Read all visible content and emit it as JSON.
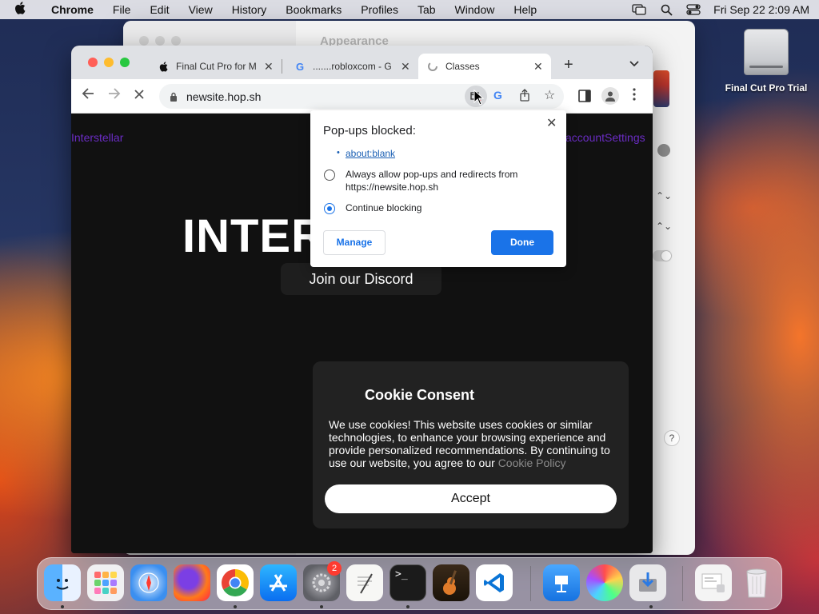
{
  "menubar": {
    "app": "Chrome",
    "items": [
      "File",
      "Edit",
      "View",
      "History",
      "Bookmarks",
      "Profiles",
      "Tab",
      "Window",
      "Help"
    ],
    "clock": "Fri Sep 22  2:09 AM"
  },
  "settings_window": {
    "title": "Appearance"
  },
  "desktop": {
    "icon_label": "Final Cut Pro Trial"
  },
  "browser": {
    "tabs": [
      {
        "title": "Final Cut Pro for M",
        "icon": "apple-icon"
      },
      {
        "title": ".......robloxcom - G",
        "icon": "google-icon"
      },
      {
        "title": "Classes",
        "icon": "site-icon",
        "active": true
      }
    ],
    "url": "newsite.hop.sh"
  },
  "page": {
    "brand_link": "Interstellar",
    "right_link": "accountSettings",
    "hero": "INTER",
    "discord_button": "Join our Discord"
  },
  "cookie": {
    "title": "Cookie Consent",
    "body": "We use cookies! This website uses cookies or similar technologies, to enhance your browsing experience and provide personalized recommendations. By continuing to use our website, you agree to our",
    "policy_link": "Cookie Policy",
    "accept": "Accept"
  },
  "popup_bubble": {
    "title": "Pop-ups blocked:",
    "link": "about:blank",
    "option_allow_line1": "Always allow pop-ups and redirects from",
    "option_allow_line2": "https://newsite.hop.sh",
    "option_block": "Continue blocking",
    "selected": "Continue blocking",
    "manage": "Manage",
    "done": "Done"
  },
  "dock": {
    "apps": [
      "finder-icon",
      "launchpad-icon",
      "safari-icon",
      "firefox-icon",
      "chrome-icon",
      "app-store-icon",
      "system-settings-icon",
      "textedit-icon",
      "terminal-icon",
      "garageband-icon",
      "vscode-icon",
      "keynote-icon",
      "pixelmator-icon",
      "installer-icon",
      "downloads-stack-icon",
      "trash-icon"
    ],
    "settings_badge": "2"
  },
  "colors": {
    "chrome_blue": "#1a73e8",
    "page_bg": "#111111",
    "link_purple": "#6a2cc4"
  }
}
